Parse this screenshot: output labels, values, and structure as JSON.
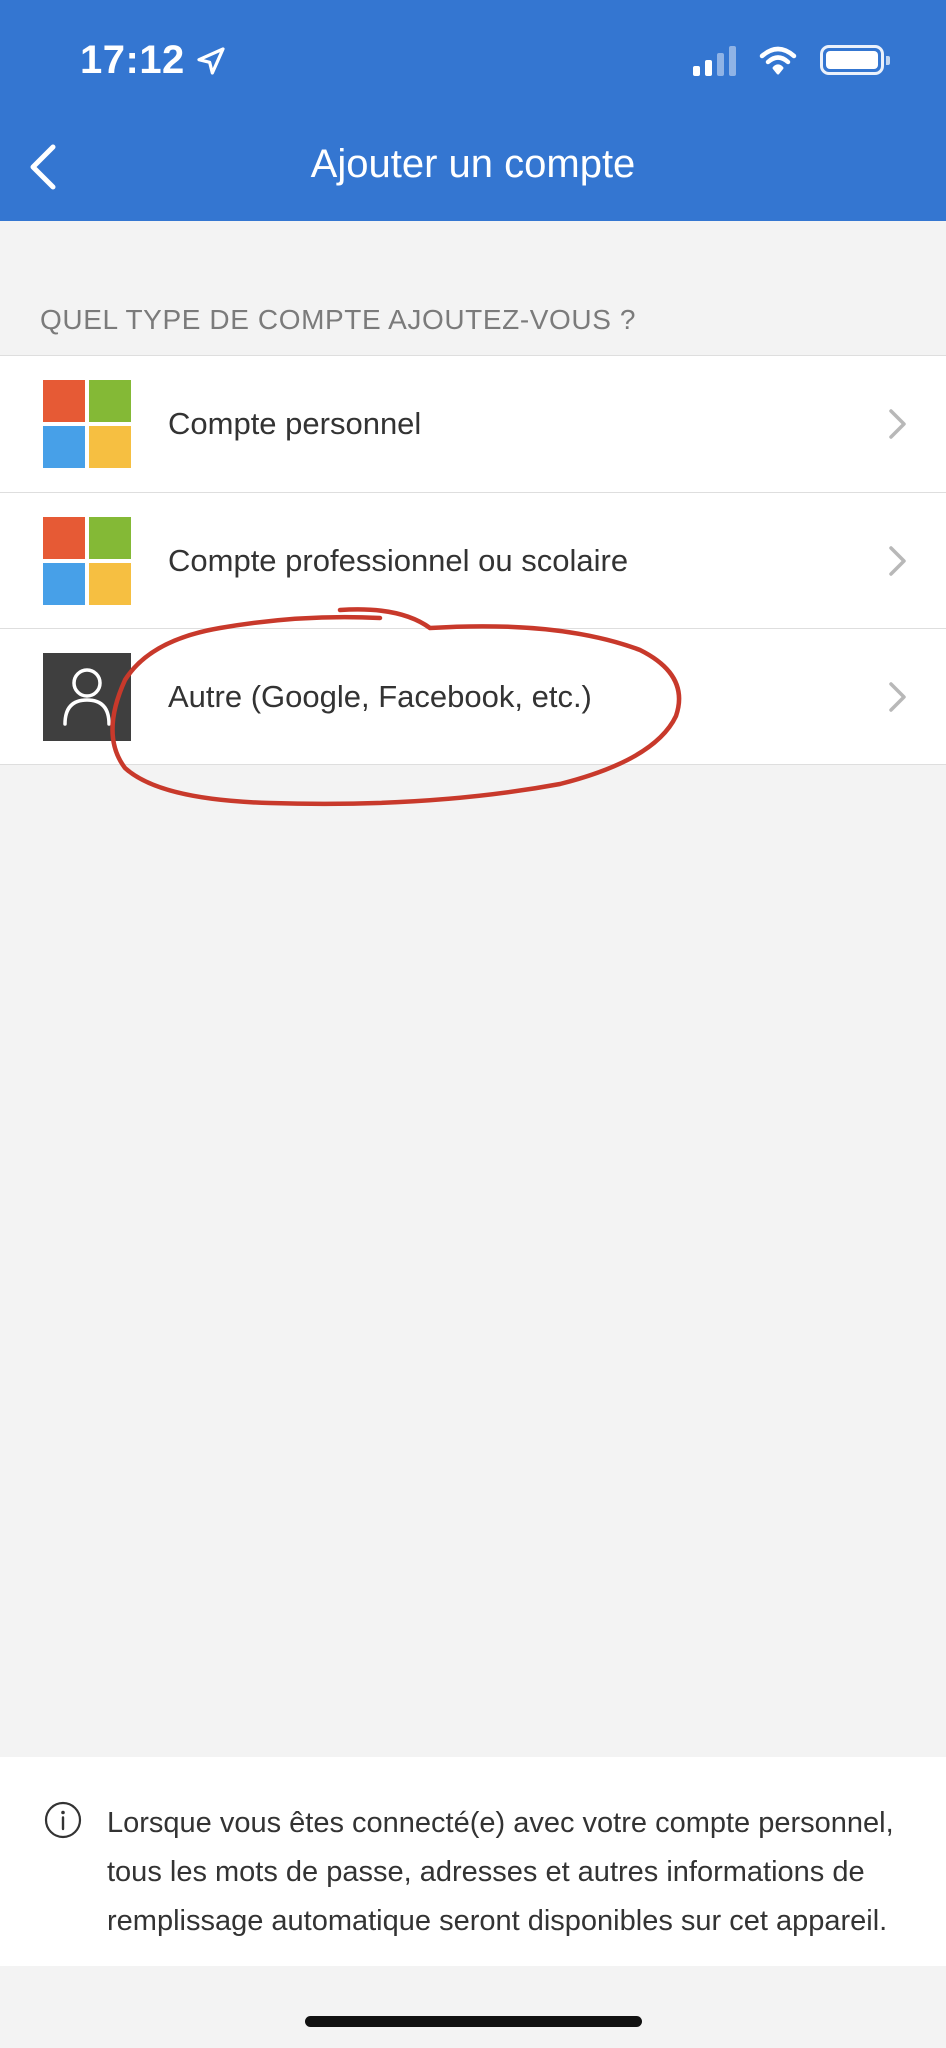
{
  "colors": {
    "accent": "#3476d1",
    "background": "#f3f3f3",
    "annotation": "#c8392b"
  },
  "status_bar": {
    "time": "17:12",
    "icons": [
      "location-arrow-icon",
      "signal-icon",
      "wifi-icon",
      "battery-icon"
    ]
  },
  "nav": {
    "back_icon": "chevron-left-icon",
    "title": "Ajouter un compte"
  },
  "section": {
    "header": "QUEL TYPE DE COMPTE AJOUTEZ-VOUS ?"
  },
  "accounts": [
    {
      "label": "Compte personnel",
      "icon": "microsoft-logo-icon"
    },
    {
      "label": "Compte professionnel ou scolaire",
      "icon": "microsoft-logo-icon"
    },
    {
      "label": "Autre (Google, Facebook, etc.)",
      "icon": "person-icon"
    }
  ],
  "info": {
    "icon": "info-icon",
    "text": "Lorsque vous êtes connecté(e) avec votre compte personnel, tous les mots de passe, adresses et autres informations de remplissage automatique seront disponibles sur cet appareil."
  }
}
